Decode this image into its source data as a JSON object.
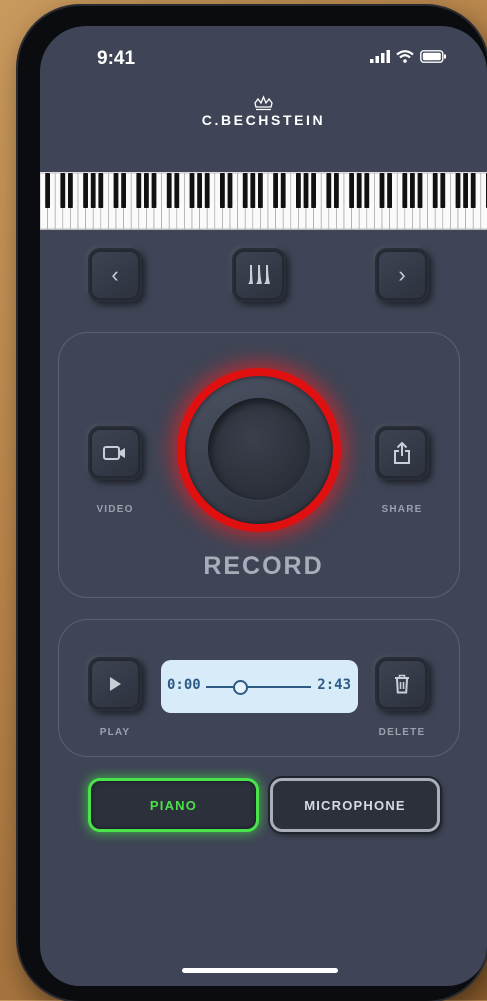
{
  "status_bar": {
    "time": "9:41"
  },
  "brand": {
    "name": "C.BECHSTEIN"
  },
  "controls": {
    "prev_label": "‹",
    "next_label": "›",
    "video_label": "VIDEO",
    "share_label": "SHARE",
    "record_label": "RECORD"
  },
  "playback": {
    "play_label": "PLAY",
    "delete_label": "DELETE",
    "current_time": "0:00",
    "total_time": "2:43",
    "progress": 0.32
  },
  "modes": {
    "piano_label": "PIANO",
    "microphone_label": "MICROPHONE",
    "active": "PIANO"
  },
  "colors": {
    "background": "#3f4556",
    "record_ring": "#e01010",
    "piano_active": "#49e34a",
    "timeline_bg": "#d7ecf8"
  },
  "icons": [
    "crown-icon",
    "chevron-left-icon",
    "chevron-right-icon",
    "pedals-icon",
    "video-camera-icon",
    "share-icon",
    "play-icon",
    "trash-icon",
    "signal-icon",
    "wifi-icon",
    "battery-icon"
  ]
}
